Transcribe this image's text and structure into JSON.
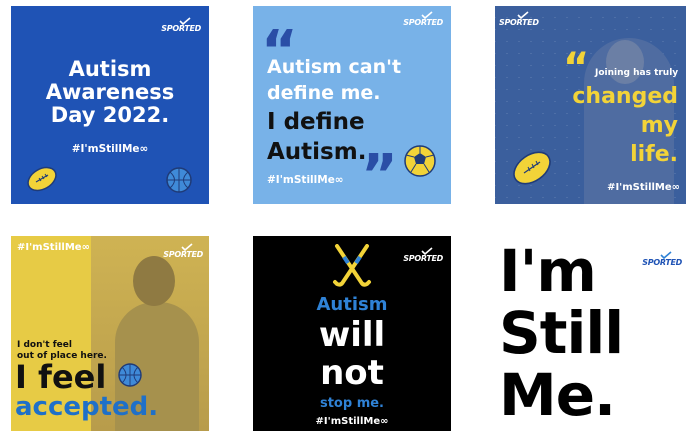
{
  "brand": {
    "logo_text": "SPORTED"
  },
  "tiles": [
    {
      "headline": [
        "Autism",
        "Awareness",
        "Day 2022."
      ],
      "hashtag": "#I'mStillMe∞"
    },
    {
      "quote_open": "“",
      "line1": [
        "Autism can't",
        "define me."
      ],
      "line2": [
        "I define",
        "Autism."
      ],
      "quote_close": "”",
      "hashtag": "#I'mStillMe∞"
    },
    {
      "quote_open": "“",
      "line1": "Joining has truly",
      "line2": [
        "changed",
        "my",
        "life."
      ],
      "hashtag": "#I'mStillMe∞"
    },
    {
      "hashtag": "#I'mStillMe∞",
      "small": [
        "I don't feel",
        "out of place here."
      ],
      "line_feel": "I feel",
      "line_acc": "accepted."
    },
    {
      "w1": "Autism",
      "w2": [
        "will",
        "not"
      ],
      "w3": "stop me.",
      "hashtag": "#I'mStillMe∞"
    },
    {
      "big": [
        "I'm",
        "Still",
        "Me."
      ]
    }
  ],
  "colors": {
    "blue": "#1f53b5",
    "light_blue": "#78b2e8",
    "yellow": "#f2d338",
    "accent_blue": "#2f82d6"
  },
  "icons": [
    "rugby-ball-icon",
    "basketball-icon",
    "football-icon",
    "hockey-sticks-icon",
    "netball-icon"
  ]
}
